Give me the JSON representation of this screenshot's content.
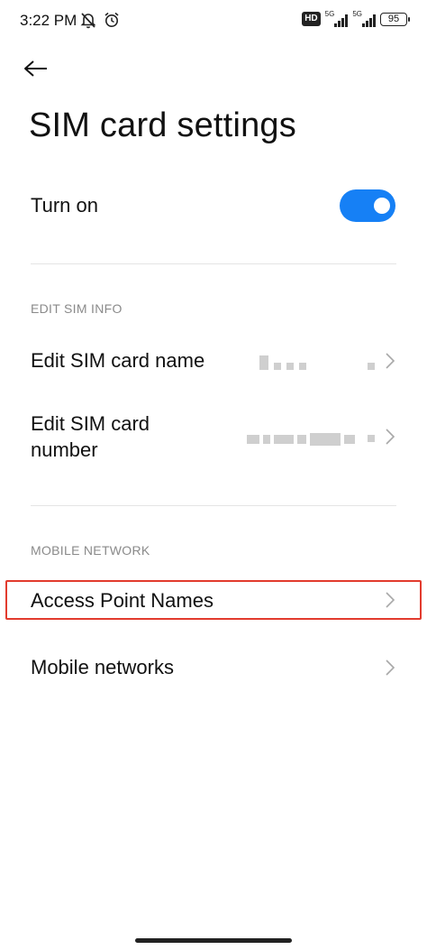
{
  "status_bar": {
    "time": "3:22 PM",
    "hd_label": "HD",
    "sim1_label": "5G",
    "sim2_label": "5G",
    "battery": "95"
  },
  "page": {
    "title": "SIM card settings"
  },
  "turn_on": {
    "label": "Turn on",
    "enabled": true,
    "accent_color": "#1680f5"
  },
  "edit_sim_info": {
    "header": "EDIT SIM INFO",
    "name_label": "Edit SIM card name",
    "number_label_line1": "Edit SIM card",
    "number_label_line2": "number"
  },
  "mobile_network": {
    "header": "MOBILE NETWORK",
    "apn_label": "Access Point Names",
    "networks_label": "Mobile networks"
  },
  "highlight_color": "#e23b2e"
}
